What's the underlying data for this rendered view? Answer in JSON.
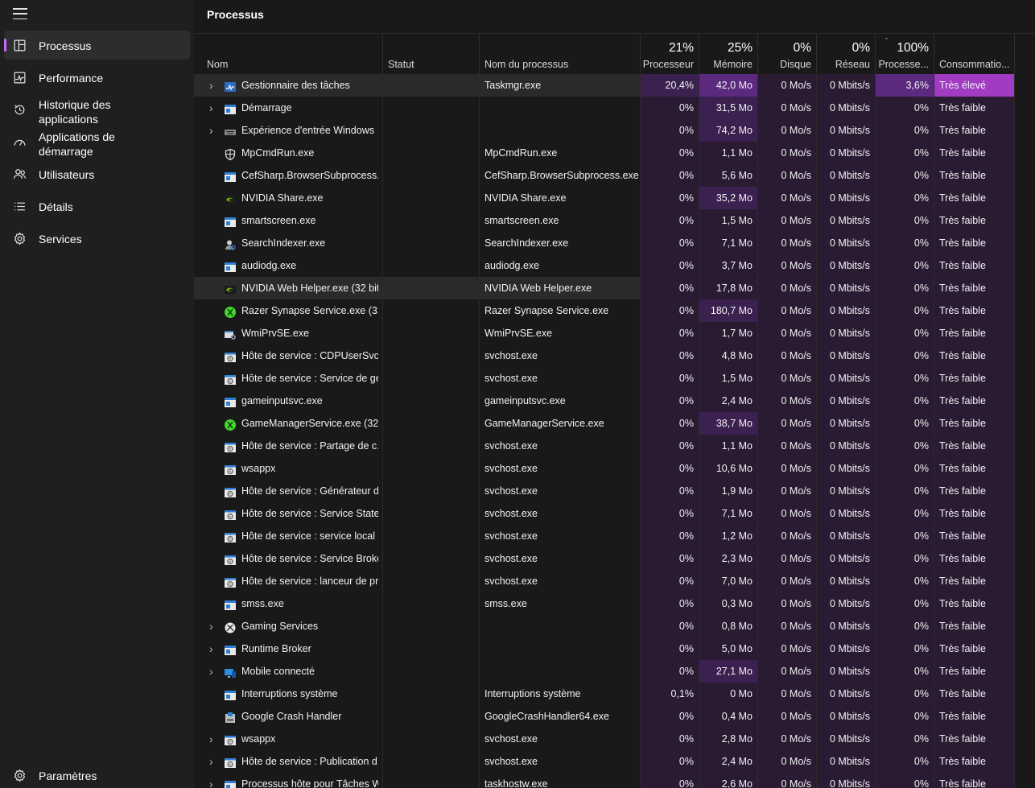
{
  "sidebar": {
    "items": [
      {
        "label": "Processus",
        "icon": "processes-icon",
        "active": true
      },
      {
        "label": "Performance",
        "icon": "performance-icon"
      },
      {
        "label": "Historique des applications",
        "icon": "history-icon"
      },
      {
        "label": "Applications de démarrage",
        "icon": "startup-apps-icon"
      },
      {
        "label": "Utilisateurs",
        "icon": "users-icon"
      },
      {
        "label": "Détails",
        "icon": "details-icon"
      },
      {
        "label": "Services",
        "icon": "services-icon"
      }
    ],
    "settings_label": "Paramètres"
  },
  "main": {
    "title": "Processus",
    "columns": {
      "name": "Nom",
      "status": "Statut",
      "process_name": "Nom du processus",
      "cpu": {
        "pct": "21%",
        "label": "Processeur"
      },
      "memory": {
        "pct": "25%",
        "label": "Mémoire"
      },
      "disk": {
        "pct": "0%",
        "label": "Disque"
      },
      "network": {
        "pct": "0%",
        "label": "Réseau"
      },
      "gpu": {
        "pct": "100%",
        "label": "Processe..."
      },
      "power": {
        "label": "Consommatio..."
      }
    }
  },
  "colors": {
    "accent": "#c76bff",
    "heat_low": "#2a1b33",
    "heat_mid": "#3b2150",
    "heat_high": "#5b2a7f",
    "power_high": "#a03bc2"
  },
  "processes": [
    {
      "name": "Gestionnaire des tâches",
      "icon": "task-manager-icon",
      "expand": true,
      "process": "Taskmgr.exe",
      "cpu": "20,4%",
      "mem": "42,0 Mo",
      "disk": "0 Mo/s",
      "net": "0 Mbits/s",
      "gpu": "3,6%",
      "power": "Très élevé",
      "hl": true,
      "heat_cpu": 2,
      "heat_mem": 3,
      "heat_gpu": 3,
      "power_high": true
    },
    {
      "name": "Démarrage",
      "icon": "window-icon",
      "expand": true,
      "process": "",
      "cpu": "0%",
      "mem": "31,5 Mo",
      "disk": "0 Mo/s",
      "net": "0 Mbits/s",
      "gpu": "0%",
      "power": "Très faible",
      "heat_mem": 2
    },
    {
      "name": "Expérience d'entrée Windows",
      "icon": "keyboard-icon",
      "expand": true,
      "process": "",
      "cpu": "0%",
      "mem": "74,2 Mo",
      "disk": "0 Mo/s",
      "net": "0 Mbits/s",
      "gpu": "0%",
      "power": "Très faible",
      "heat_mem": 2
    },
    {
      "name": "MpCmdRun.exe",
      "icon": "shield-icon",
      "process": "MpCmdRun.exe",
      "cpu": "0%",
      "mem": "1,1 Mo",
      "disk": "0 Mo/s",
      "net": "0 Mbits/s",
      "gpu": "0%",
      "power": "Très faible"
    },
    {
      "name": "CefSharp.BrowserSubprocess....",
      "icon": "window-icon",
      "process": "CefSharp.BrowserSubprocess.exe",
      "cpu": "0%",
      "mem": "5,6 Mo",
      "disk": "0 Mo/s",
      "net": "0 Mbits/s",
      "gpu": "0%",
      "power": "Très faible"
    },
    {
      "name": "NVIDIA Share.exe",
      "icon": "nvidia-icon",
      "process": "NVIDIA Share.exe",
      "cpu": "0%",
      "mem": "35,2 Mo",
      "disk": "0 Mo/s",
      "net": "0 Mbits/s",
      "gpu": "0%",
      "power": "Très faible",
      "heat_mem": 2
    },
    {
      "name": "smartscreen.exe",
      "icon": "window-icon",
      "process": "smartscreen.exe",
      "cpu": "0%",
      "mem": "1,5 Mo",
      "disk": "0 Mo/s",
      "net": "0 Mbits/s",
      "gpu": "0%",
      "power": "Très faible"
    },
    {
      "name": "SearchIndexer.exe",
      "icon": "search-indexer-icon",
      "process": "SearchIndexer.exe",
      "cpu": "0%",
      "mem": "7,1 Mo",
      "disk": "0 Mo/s",
      "net": "0 Mbits/s",
      "gpu": "0%",
      "power": "Très faible"
    },
    {
      "name": "audiodg.exe",
      "icon": "window-icon",
      "process": "audiodg.exe",
      "cpu": "0%",
      "mem": "3,7 Mo",
      "disk": "0 Mo/s",
      "net": "0 Mbits/s",
      "gpu": "0%",
      "power": "Très faible"
    },
    {
      "name": "NVIDIA Web Helper.exe (32 bits)",
      "icon": "nvidia-icon",
      "process": "NVIDIA Web Helper.exe",
      "cpu": "0%",
      "mem": "17,8 Mo",
      "disk": "0 Mo/s",
      "net": "0 Mbits/s",
      "gpu": "0%",
      "power": "Très faible",
      "hl": true
    },
    {
      "name": "Razer Synapse Service.exe (32 ...",
      "icon": "razer-icon",
      "process": "Razer Synapse Service.exe",
      "cpu": "0%",
      "mem": "180,7 Mo",
      "disk": "0 Mo/s",
      "net": "0 Mbits/s",
      "gpu": "0%",
      "power": "Très faible",
      "heat_mem": 2
    },
    {
      "name": "WmiPrvSE.exe",
      "icon": "wmi-icon",
      "process": "WmiPrvSE.exe",
      "cpu": "0%",
      "mem": "1,7 Mo",
      "disk": "0 Mo/s",
      "net": "0 Mbits/s",
      "gpu": "0%",
      "power": "Très faible"
    },
    {
      "name": "Hôte de service : CDPUserSvc_...",
      "icon": "service-host-icon",
      "process": "svchost.exe",
      "cpu": "0%",
      "mem": "4,8 Mo",
      "disk": "0 Mo/s",
      "net": "0 Mbits/s",
      "gpu": "0%",
      "power": "Très faible"
    },
    {
      "name": "Hôte de service : Service de ge...",
      "icon": "service-host-icon",
      "process": "svchost.exe",
      "cpu": "0%",
      "mem": "1,5 Mo",
      "disk": "0 Mo/s",
      "net": "0 Mbits/s",
      "gpu": "0%",
      "power": "Très faible"
    },
    {
      "name": "gameinputsvc.exe",
      "icon": "window-icon",
      "process": "gameinputsvc.exe",
      "cpu": "0%",
      "mem": "2,4 Mo",
      "disk": "0 Mo/s",
      "net": "0 Mbits/s",
      "gpu": "0%",
      "power": "Très faible"
    },
    {
      "name": "GameManagerService.exe (32 ...",
      "icon": "razer-icon",
      "process": "GameManagerService.exe",
      "cpu": "0%",
      "mem": "38,7 Mo",
      "disk": "0 Mo/s",
      "net": "0 Mbits/s",
      "gpu": "0%",
      "power": "Très faible",
      "heat_mem": 2
    },
    {
      "name": "Hôte de service : Partage de c...",
      "icon": "service-host-icon",
      "process": "svchost.exe",
      "cpu": "0%",
      "mem": "1,1 Mo",
      "disk": "0 Mo/s",
      "net": "0 Mbits/s",
      "gpu": "0%",
      "power": "Très faible"
    },
    {
      "name": "wsappx",
      "icon": "service-host-icon",
      "process": "svchost.exe",
      "cpu": "0%",
      "mem": "10,6 Mo",
      "disk": "0 Mo/s",
      "net": "0 Mbits/s",
      "gpu": "0%",
      "power": "Très faible"
    },
    {
      "name": "Hôte de service : Générateur d...",
      "icon": "service-host-icon",
      "process": "svchost.exe",
      "cpu": "0%",
      "mem": "1,9 Mo",
      "disk": "0 Mo/s",
      "net": "0 Mbits/s",
      "gpu": "0%",
      "power": "Très faible"
    },
    {
      "name": "Hôte de service : Service State ...",
      "icon": "service-host-icon",
      "process": "svchost.exe",
      "cpu": "0%",
      "mem": "7,1 Mo",
      "disk": "0 Mo/s",
      "net": "0 Mbits/s",
      "gpu": "0%",
      "power": "Très faible"
    },
    {
      "name": "Hôte de service : service local ...",
      "icon": "service-host-icon",
      "process": "svchost.exe",
      "cpu": "0%",
      "mem": "1,2 Mo",
      "disk": "0 Mo/s",
      "net": "0 Mbits/s",
      "gpu": "0%",
      "power": "Très faible"
    },
    {
      "name": "Hôte de service : Service Broke...",
      "icon": "service-host-icon",
      "process": "svchost.exe",
      "cpu": "0%",
      "mem": "2,3 Mo",
      "disk": "0 Mo/s",
      "net": "0 Mbits/s",
      "gpu": "0%",
      "power": "Très faible"
    },
    {
      "name": "Hôte de service : lanceur de pr...",
      "icon": "service-host-icon",
      "process": "svchost.exe",
      "cpu": "0%",
      "mem": "7,0 Mo",
      "disk": "0 Mo/s",
      "net": "0 Mbits/s",
      "gpu": "0%",
      "power": "Très faible"
    },
    {
      "name": "smss.exe",
      "icon": "window-icon",
      "process": "smss.exe",
      "cpu": "0%",
      "mem": "0,3 Mo",
      "disk": "0 Mo/s",
      "net": "0 Mbits/s",
      "gpu": "0%",
      "power": "Très faible"
    },
    {
      "name": "Gaming Services",
      "icon": "xbox-icon",
      "expand": true,
      "process": "",
      "cpu": "0%",
      "mem": "0,8 Mo",
      "disk": "0 Mo/s",
      "net": "0 Mbits/s",
      "gpu": "0%",
      "power": "Très faible"
    },
    {
      "name": "Runtime Broker",
      "icon": "window-icon",
      "expand": true,
      "process": "",
      "cpu": "0%",
      "mem": "5,0 Mo",
      "disk": "0 Mo/s",
      "net": "0 Mbits/s",
      "gpu": "0%",
      "power": "Très faible"
    },
    {
      "name": "Mobile connecté",
      "icon": "phone-link-icon",
      "expand": true,
      "process": "",
      "cpu": "0%",
      "mem": "27,1 Mo",
      "disk": "0 Mo/s",
      "net": "0 Mbits/s",
      "gpu": "0%",
      "power": "Très faible",
      "heat_mem": 2
    },
    {
      "name": "Interruptions système",
      "icon": "window-icon",
      "process": "Interruptions système",
      "cpu": "0,1%",
      "mem": "0 Mo",
      "disk": "0 Mo/s",
      "net": "0 Mbits/s",
      "gpu": "0%",
      "power": "Très faible"
    },
    {
      "name": "Google Crash Handler",
      "icon": "installer-icon",
      "process": "GoogleCrashHandler64.exe",
      "cpu": "0%",
      "mem": "0,4 Mo",
      "disk": "0 Mo/s",
      "net": "0 Mbits/s",
      "gpu": "0%",
      "power": "Très faible"
    },
    {
      "name": "wsappx",
      "icon": "service-host-icon",
      "expand": true,
      "process": "svchost.exe",
      "cpu": "0%",
      "mem": "2,8 Mo",
      "disk": "0 Mo/s",
      "net": "0 Mbits/s",
      "gpu": "0%",
      "power": "Très faible"
    },
    {
      "name": "Hôte de service : Publication d...",
      "icon": "service-host-icon",
      "expand": true,
      "process": "svchost.exe",
      "cpu": "0%",
      "mem": "2,4 Mo",
      "disk": "0 Mo/s",
      "net": "0 Mbits/s",
      "gpu": "0%",
      "power": "Très faible"
    },
    {
      "name": "Processus hôte pour Tâches W...",
      "icon": "window-icon",
      "expand": true,
      "process": "taskhostw.exe",
      "cpu": "0%",
      "mem": "2,6 Mo",
      "disk": "0 Mo/s",
      "net": "0 Mbits/s",
      "gpu": "0%",
      "power": "Très faible"
    }
  ]
}
